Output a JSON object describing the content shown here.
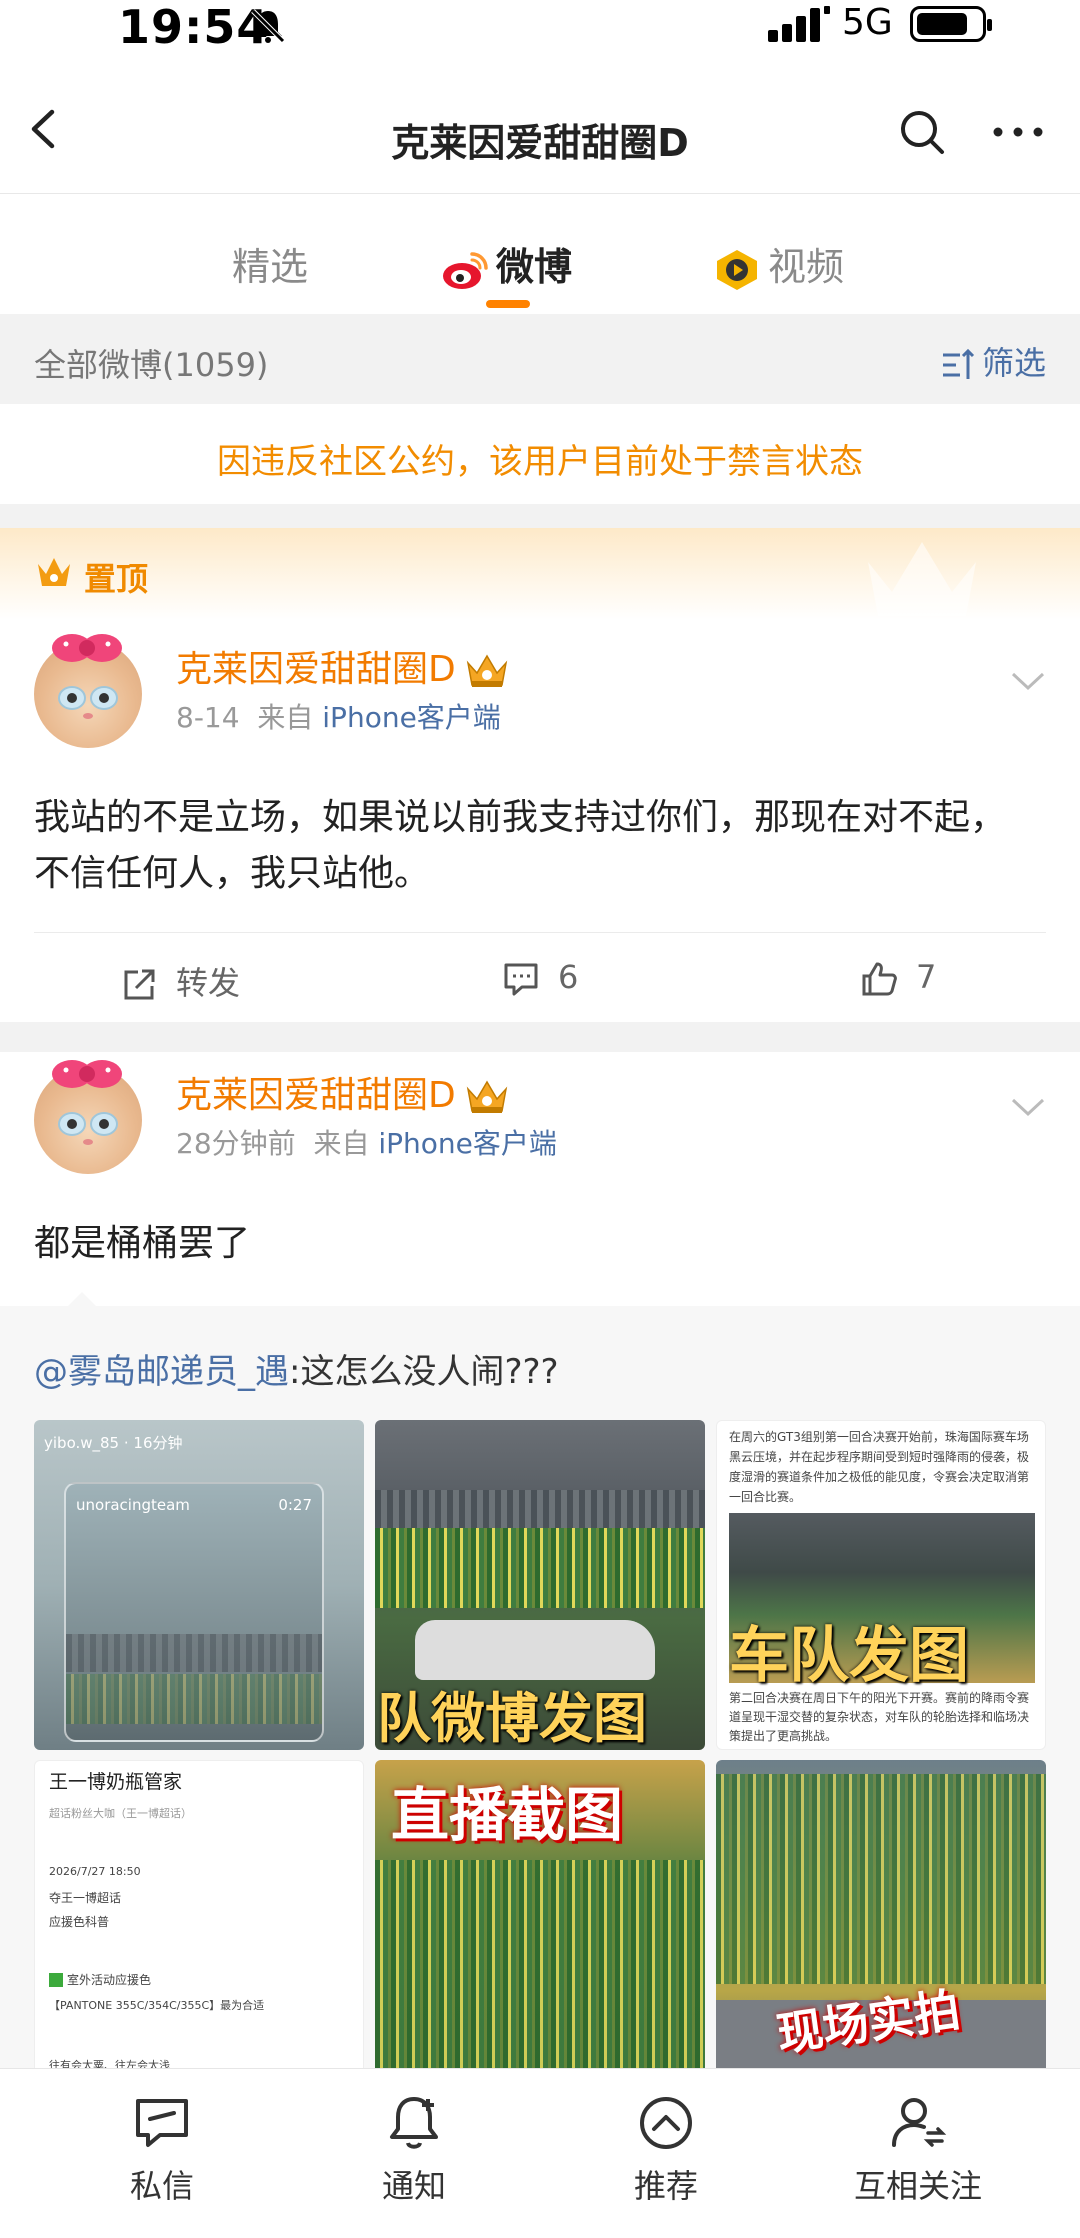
{
  "status_bar": {
    "time": "19:54",
    "network": "5G"
  },
  "header": {
    "title": "克莱因爱甜甜圈D"
  },
  "tabs": [
    {
      "label": "精选"
    },
    {
      "label": "微博"
    },
    {
      "label": "视频"
    }
  ],
  "filter_bar": {
    "count_label": "全部微博(1059)",
    "filter_label": "筛选"
  },
  "notice": "因违反社区公约，该用户目前处于禁言状态",
  "pinned_label": "置顶",
  "posts": [
    {
      "username": "克莱因爱甜甜圈D",
      "time": "8-14",
      "source_prefix": "来自",
      "source": "iPhone客户端",
      "text": "我站的不是立场，如果说以前我支持过你们，那现在对不起， 不信任何人，我只站他。",
      "forward_label": "转发",
      "comments": "6",
      "likes": "7"
    },
    {
      "username": "克莱因爱甜甜圈D",
      "time": "28分钟前",
      "source_prefix": "来自",
      "source": "iPhone客户端",
      "text": "都是桶桶罢了",
      "retweet": {
        "author": "@雾岛邮递员_遇",
        "text": ":这怎么没人闹???",
        "images": [
          {
            "caption": "",
            "header": "yibo.w_85 · 16分钟",
            "sub": "unoracingteam",
            "badge": "0:27"
          },
          {
            "caption": "队微博发图"
          },
          {
            "caption": "车队发图",
            "text_top": "在周六的GT3组别第一回合决赛开始前，珠海国际赛车场黑云压境，并在起步程序期间受到短时强降雨的侵袭，极度湿滑的赛道条件加之极低的能见度，令赛会决定取消第一回合比赛。",
            "text_bottom": "第二回合决赛在周日下午的阳光下开赛。赛前的降雨令赛道呈现干湿交替的复杂状态，对车队的轮胎选择和临场决策提出了更高挑战。"
          },
          {
            "caption": "",
            "title": "王一博奶瓶管家",
            "line1": "超话粉丝大咖（王一博超话）",
            "line2": "2026/7/27 18:50",
            "line3": "夺王一博超话",
            "line4": "应援色科普",
            "line5": "室外活动应援色",
            "line6": "【PANTONE 355C/354C/355C】最为合适",
            "line7": "往有会太粟、往左会太浅"
          },
          {
            "caption": "直播截图"
          },
          {
            "caption": "现场实拍"
          }
        ]
      }
    }
  ],
  "bottom_nav": [
    {
      "label": "私信"
    },
    {
      "label": "通知"
    },
    {
      "label": "推荐"
    },
    {
      "label": "互相关注"
    }
  ],
  "colors": {
    "accent": "#ff8200",
    "username": "#f27b00",
    "link": "#4a6fa5",
    "notice": "#f28c00"
  }
}
